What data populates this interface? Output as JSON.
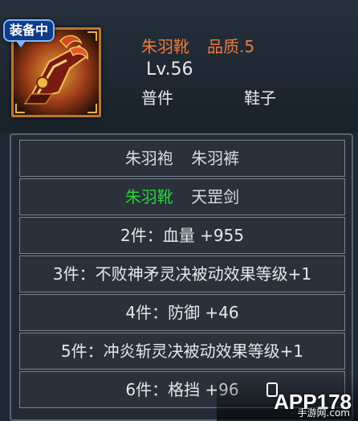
{
  "badge": {
    "label": "装备中"
  },
  "item": {
    "icon": "red-feather-boots-icon",
    "name": "朱羽靴",
    "quality": "品质.5",
    "level": "Lv.56",
    "category": "普件",
    "slot": "鞋子"
  },
  "set": {
    "pieces_row1": [
      {
        "name": "朱羽袍",
        "owned": false
      },
      {
        "name": "朱羽裤",
        "owned": false
      }
    ],
    "pieces_row2": [
      {
        "name": "朱羽靴",
        "owned": true
      },
      {
        "name": "天罡剑",
        "owned": false
      }
    ],
    "bonuses": [
      "2件：血量 +955",
      "3件：不败神矛灵决被动效果等级+1",
      "4件：防御 +46",
      "5件：冲炎斩灵决被动效果等级+1",
      "6件：格挡 +96"
    ]
  },
  "colors": {
    "item_name": "#f07a3a",
    "owned_piece": "#26d43a",
    "text": "#e6e8ea",
    "badge_bg": "#0f3b88",
    "frame_gold": "#b8782b"
  },
  "watermark": {
    "logo": "APP178",
    "sub": "手游网",
    "domain": ".com"
  }
}
